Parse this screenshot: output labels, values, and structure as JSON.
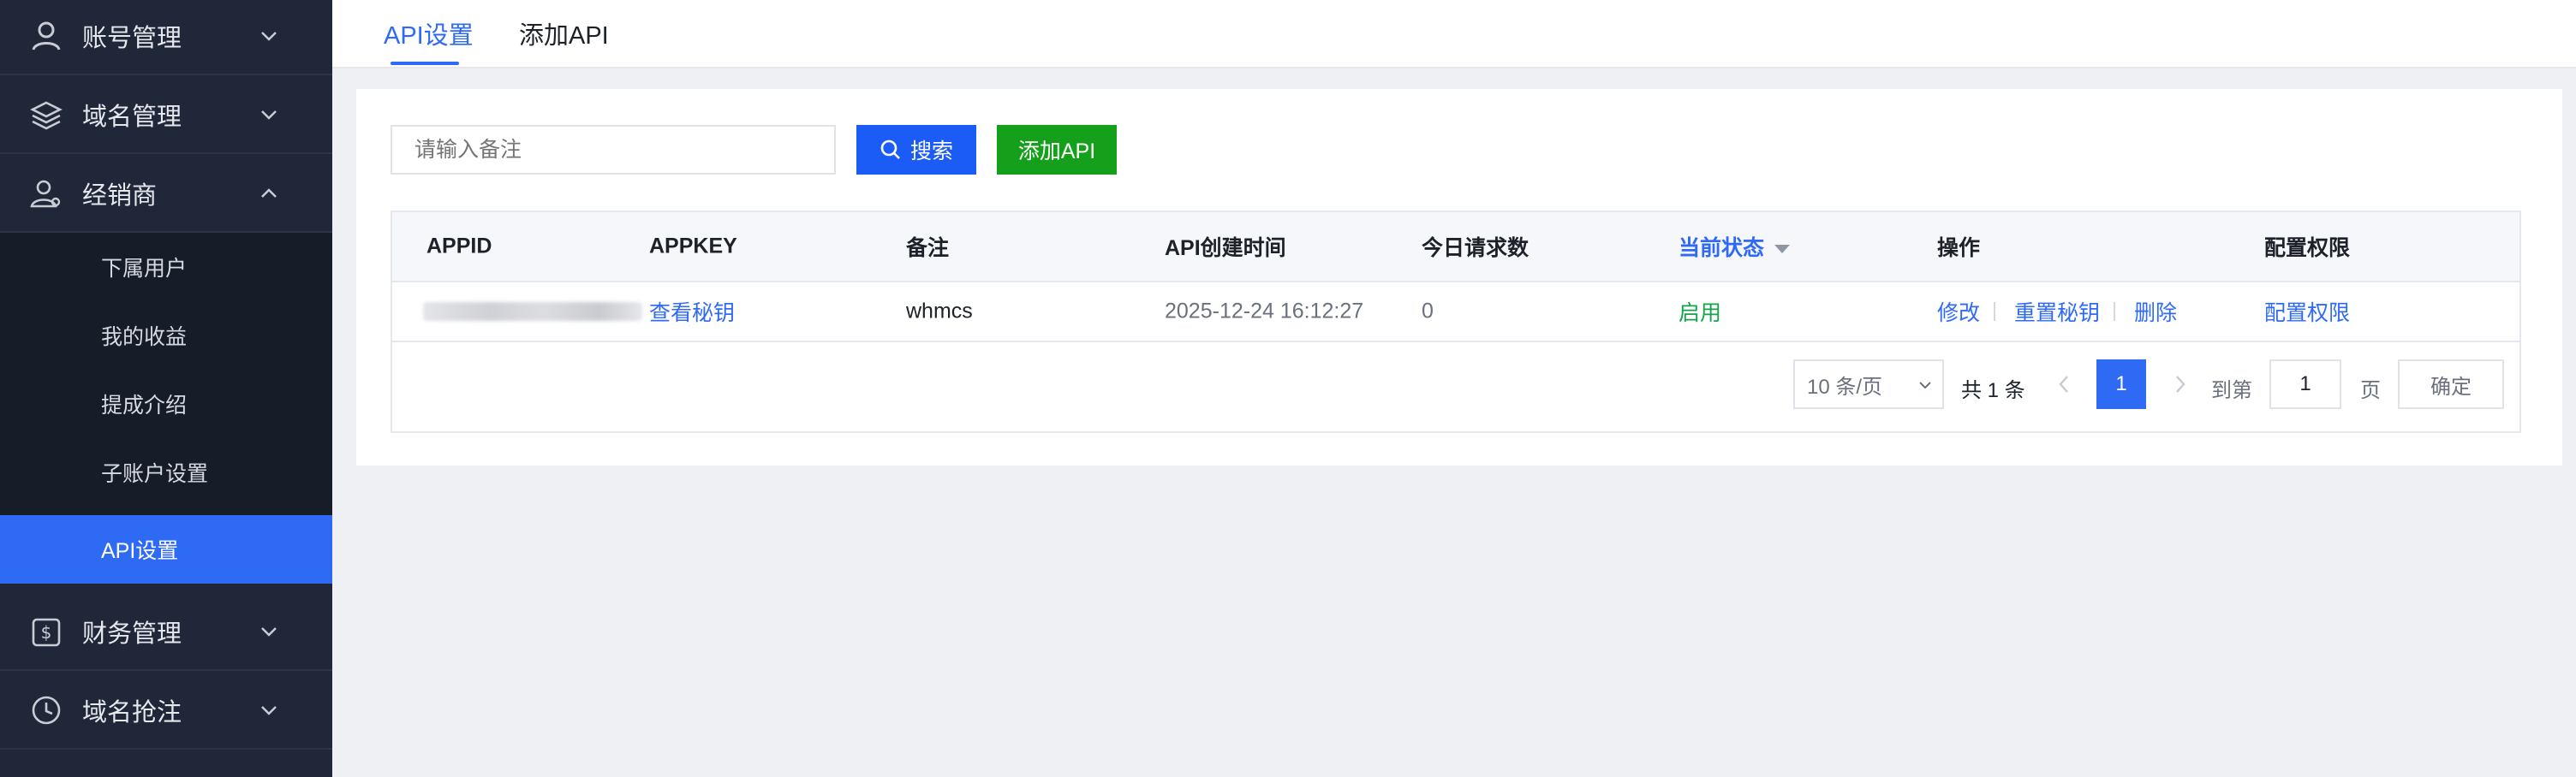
{
  "sidebar": {
    "groups": [
      {
        "label": "账号管理",
        "icon": "user-icon",
        "arrow": "chevron-down-icon"
      },
      {
        "label": "域名管理",
        "icon": "layers-icon",
        "arrow": "chevron-down-icon"
      },
      {
        "label": "经销商",
        "icon": "user-group-icon",
        "arrow": "chevron-up-icon"
      },
      {
        "label": "财务管理",
        "icon": "dollar-icon",
        "arrow": "chevron-down-icon"
      },
      {
        "label": "域名抢注",
        "icon": "clock-icon",
        "arrow": "chevron-down-icon"
      }
    ],
    "submenu": [
      {
        "label": "下属用户"
      },
      {
        "label": "我的收益"
      },
      {
        "label": "提成介绍"
      },
      {
        "label": "子账户设置"
      },
      {
        "label": "API设置",
        "active": true
      }
    ]
  },
  "tabs": [
    {
      "label": "API设置",
      "active": true
    },
    {
      "label": "添加API",
      "active": false
    }
  ],
  "toolbar": {
    "search_placeholder": "请输入备注",
    "search_label": "搜索",
    "add_label": "添加API"
  },
  "table": {
    "headers": [
      "APPID",
      "APPKEY",
      "备注",
      "API创建时间",
      "今日请求数",
      "当前状态",
      "操作",
      "配置权限"
    ],
    "rows": [
      {
        "appid": "",
        "appkey": "查看秘钥",
        "note": "whmcs",
        "created": "2025-12-24 16:12:27",
        "requests": "0",
        "status": "启用",
        "actions": [
          "修改",
          "重置秘钥",
          "删除"
        ],
        "perm": "配置权限"
      }
    ]
  },
  "pagination": {
    "page_size": "10 条/页",
    "total": "共 1 条",
    "current": "1",
    "goto_label": "到第",
    "goto_value": "1",
    "page_suffix": "页",
    "confirm": "确定"
  },
  "colors": {
    "sidebar_bg": "#1f2738",
    "accent": "#2f6af5",
    "add_button": "#15a01c",
    "status_enabled": "#16a34a"
  }
}
